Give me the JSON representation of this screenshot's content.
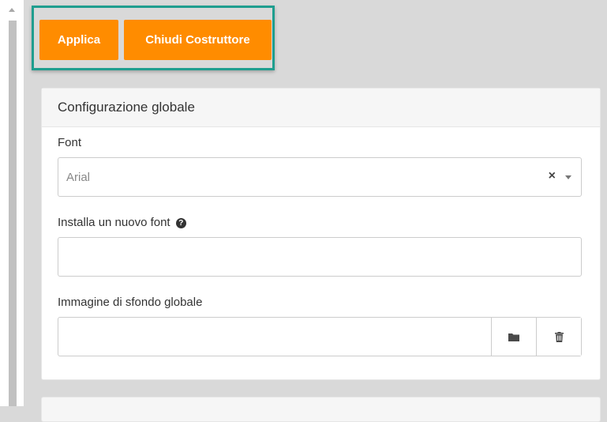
{
  "toolbar": {
    "apply_label": "Applica",
    "close_label": "Chiudi Costruttore"
  },
  "panel": {
    "title": "Configurazione globale",
    "font_label": "Font",
    "font_value": "Arial",
    "install_font_label": "Installa un nuovo font",
    "install_font_value": "",
    "background_image_label": "Immagine di sfondo globale",
    "background_image_value": ""
  },
  "colors": {
    "accent": "#ff8c00",
    "highlight_border": "#1f9e8f"
  }
}
